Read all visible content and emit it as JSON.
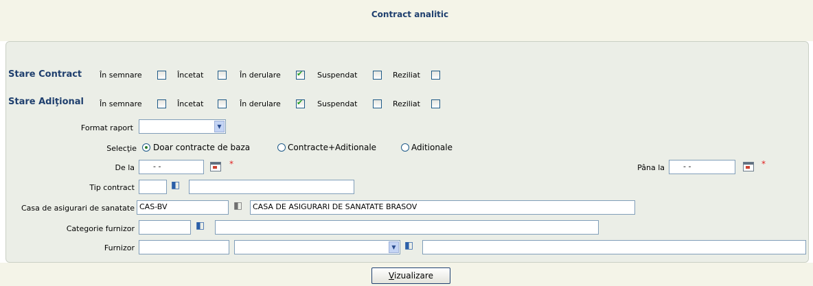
{
  "page": {
    "title": "Contract analitic"
  },
  "stare_contract": {
    "label": "Stare Contract",
    "options": [
      {
        "label": "În semnare",
        "checked": false
      },
      {
        "label": "Încetat",
        "checked": false
      },
      {
        "label": "În derulare",
        "checked": true
      },
      {
        "label": "Suspendat",
        "checked": false
      },
      {
        "label": "Reziliat",
        "checked": false
      }
    ]
  },
  "stare_aditional": {
    "label": "Stare Adiţional",
    "options": [
      {
        "label": "În semnare",
        "checked": false
      },
      {
        "label": "Încetat",
        "checked": false
      },
      {
        "label": "În derulare",
        "checked": true
      },
      {
        "label": "Suspendat",
        "checked": false
      },
      {
        "label": "Reziliat",
        "checked": false
      }
    ]
  },
  "format_raport": {
    "label": "Format raport",
    "value": ""
  },
  "selectie": {
    "label": "Selecţie",
    "options": [
      "Doar contracte de baza",
      "Contracte+Aditionale",
      "Aditionale"
    ],
    "selected": "Doar contracte de baza"
  },
  "de_la": {
    "label": "De la",
    "value": "-   -",
    "required": "*"
  },
  "pana_la": {
    "label": "Pâna la",
    "value": "-   -",
    "required": "*"
  },
  "tip_contract": {
    "label": "Tip contract",
    "code": "",
    "name": ""
  },
  "casa": {
    "label": "Casa de asigurari de sanatate",
    "code": "CAS-BV",
    "name": "CASA DE ASIGURARI DE SANATATE BRASOV"
  },
  "categorie_furnizor": {
    "label": "Categorie furnizor",
    "code": "",
    "name": ""
  },
  "furnizor": {
    "label": "Furnizor",
    "code": "",
    "select": "",
    "name": ""
  },
  "actions": {
    "view_prefix": "V",
    "view_rest": "izualizare"
  },
  "icons": {
    "checkbox": "checkbox-icon",
    "calendar": "calendar-icon",
    "lookup": "book-lookup-icon",
    "dropdown": "chevron-down-icon"
  }
}
